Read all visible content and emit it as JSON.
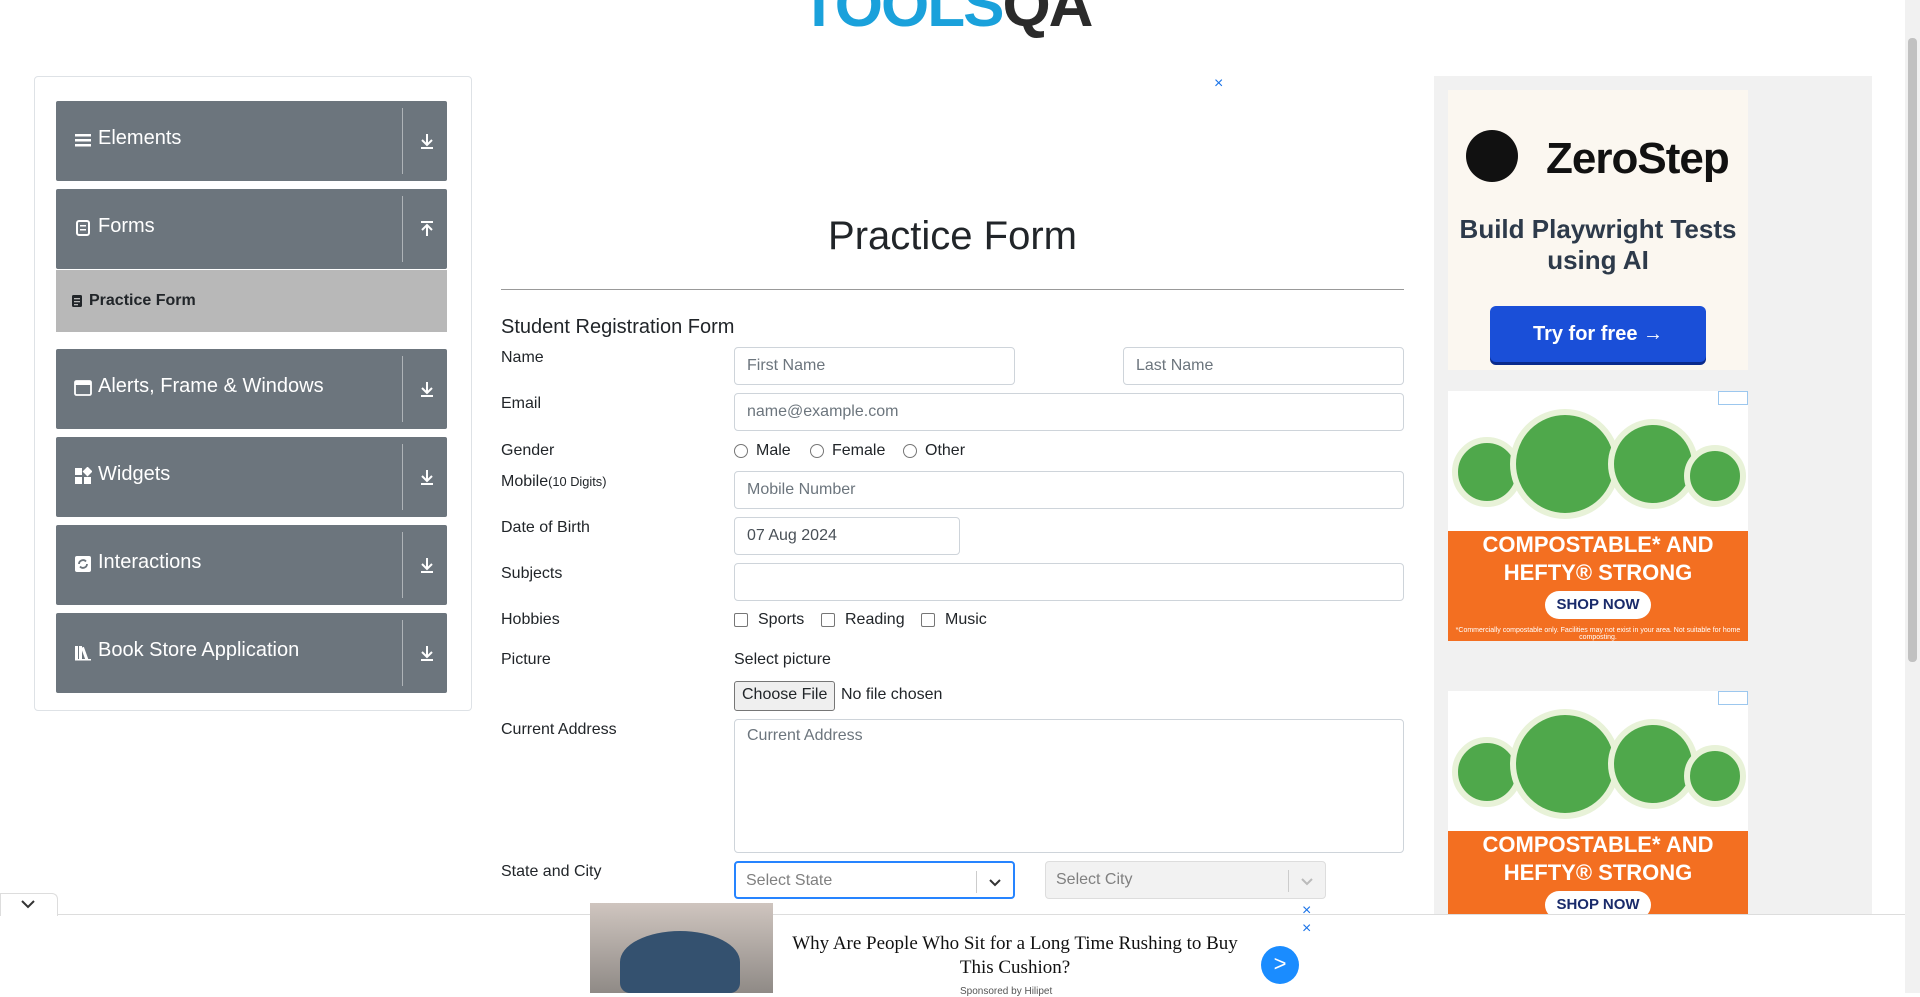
{
  "logo": {
    "text": "TOOLS",
    "suffix": "QA"
  },
  "sidebar": {
    "groups": [
      {
        "label": "Elements",
        "icon": "hamburger-icon",
        "arrow": "download-arrow-icon"
      },
      {
        "label": "Forms",
        "icon": "document-icon",
        "arrow": "upload-arrow-icon"
      },
      {
        "label": "Alerts, Frame & Windows",
        "icon": "window-icon",
        "arrow": "download-arrow-icon"
      },
      {
        "label": "Widgets",
        "icon": "widgets-icon",
        "arrow": "download-arrow-icon"
      },
      {
        "label": "Interactions",
        "icon": "interactions-icon",
        "arrow": "download-arrow-icon"
      },
      {
        "label": "Book Store Application",
        "icon": "books-icon",
        "arrow": "download-arrow-icon"
      }
    ],
    "active_item": "Practice Form"
  },
  "page": {
    "title": "Practice Form"
  },
  "form": {
    "heading": "Student Registration Form",
    "name_label": "Name",
    "first_name_placeholder": "First Name",
    "last_name_placeholder": "Last Name",
    "email_label": "Email",
    "email_placeholder": "name@example.com",
    "gender_label": "Gender",
    "gender_options": [
      "Male",
      "Female",
      "Other"
    ],
    "mobile_label": "Mobile",
    "mobile_hint": "(10 Digits)",
    "mobile_placeholder": "Mobile Number",
    "dob_label": "Date of Birth",
    "dob_value": "07 Aug 2024",
    "subjects_label": "Subjects",
    "hobbies_label": "Hobbies",
    "hobbies_options": [
      "Sports",
      "Reading",
      "Music"
    ],
    "picture_label": "Picture",
    "picture_select_label": "Select picture",
    "choose_file": "Choose File",
    "no_file": "No file chosen",
    "address_label": "Current Address",
    "address_placeholder": "Current Address",
    "state_city_label": "State and City",
    "state_placeholder": "Select State",
    "city_placeholder": "Select City"
  },
  "ads": {
    "top_close": "×",
    "zerostep": {
      "brand": "ZeroStep",
      "tagline": "Build Playwright Tests using AI",
      "cta": "Try for free →"
    },
    "hefty": {
      "headline": "COMPOSTABLE* AND HEFTY® STRONG",
      "cta": "SHOP NOW",
      "fine": "*Commercially compostable only. Facilities may not exist in your area. Not suitable for home composting."
    },
    "bottom": {
      "headline": "Why Are People Who Sit for a Long Time Rushing to Buy This Cushion?",
      "sponsor": "Sponsored by Hilipet",
      "go": ">",
      "close": "×"
    }
  },
  "colors": {
    "sidebar_group": "#6c757d",
    "active_item": "#b8b8b8",
    "focus_border": "#2684ff"
  }
}
